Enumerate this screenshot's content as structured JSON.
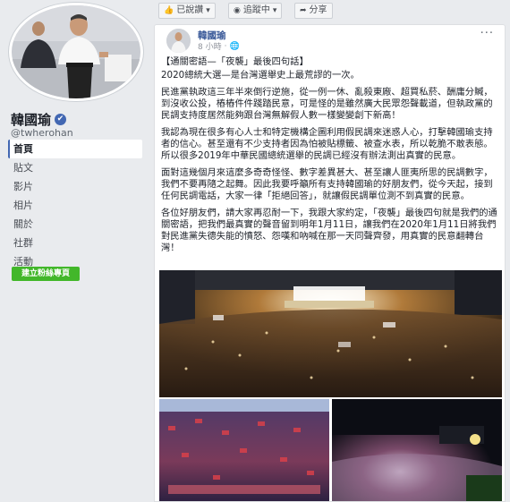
{
  "sidebar": {
    "name": "韓國瑜",
    "verified_badge": "✔",
    "handle": "@twherohan",
    "nav": [
      {
        "label": "首頁",
        "active": true
      },
      {
        "label": "貼文",
        "active": false
      },
      {
        "label": "影片",
        "active": false
      },
      {
        "label": "相片",
        "active": false
      },
      {
        "label": "關於",
        "active": false
      },
      {
        "label": "社群",
        "active": false
      },
      {
        "label": "活動",
        "active": false
      }
    ],
    "create_button": "建立粉絲專頁"
  },
  "topbar": {
    "liked_label": "已說讚",
    "following_label": "追蹤中",
    "share_label": "分享"
  },
  "post": {
    "author": "韓國瑜",
    "time": "8 小時",
    "visibility_icon": "globe-icon",
    "title": "【通關密語—「夜襲」最後四句話】",
    "paragraphs": [
      "2020總統大選—是台灣選舉史上最荒謬的一次。",
      "民進黨執政這三年半來倒行逆施，從一例一休、亂殺東廠、超買私菸、酬庸分贓，到沒收公投，樁樁件件踐踏民意，可是怪的是雖然廣大民眾怨聲載道，但執政黨的民調支持度居然能夠跟台灣無解假人數一樣變變創下新高！",
      "我認為現在很多有心人士和特定機構企圖利用假民調來迷惑人心，打擊韓國瑜支持者的信心。甚至還有不少支持者因為怕被貼標籤、被查水表，所以乾脆不敢表態。所以很多2019年中華民國總統選舉的民調已經沒有辦法測出真實的民意。",
      "面對這幾個月來這麼多奇奇怪怪、數字差異甚大、甚至讓人匪夷所思的民調數字，我們不要再隨之起舞。因此我要呼籲所有支持韓國瑜的好朋友們，從今天起，接到任何民調電話，大家一律「拒絕回答」，就讓假民調單位測不到真實的民意。",
      "各位好朋友們，請大家再忍耐一下，我跟大家約定，「夜襲」最後四句就是我們的通關密語，把我們最真實的聲音留到明年1月11日，讓我們在2020年1月11日將我們對民進黨失德失能的憤怒、怨嘆和吶喊在那一天同聲齊發，用真實的民意翻轉台灣！"
    ]
  },
  "icons": {
    "like": "thumbs-up-icon",
    "follow": "rss-icon",
    "share": "share-arrow-icon",
    "more": "more-dots-icon"
  },
  "colors": {
    "page_bg": "#e9ebee",
    "link_blue": "#385898",
    "accent_blue": "#4267b2",
    "create_green": "#42b72a"
  }
}
